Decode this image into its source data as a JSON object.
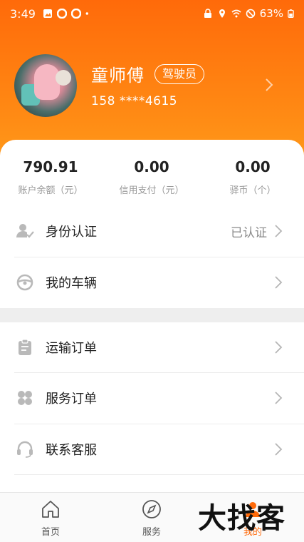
{
  "status_bar": {
    "time": "3:49",
    "battery": "63%"
  },
  "profile": {
    "name": "童师傅",
    "role": "驾驶员",
    "phone": "158 ****4615"
  },
  "stats": [
    {
      "value": "790.91",
      "label": "账户余额（元）"
    },
    {
      "value": "0.00",
      "label": "信用支付（元）"
    },
    {
      "value": "0.00",
      "label": "驿币（个）"
    }
  ],
  "menu": [
    {
      "label": "身份认证",
      "value": "已认证",
      "icon": "user-check-icon"
    },
    {
      "label": "我的车辆",
      "icon": "steering-wheel-icon"
    },
    {
      "label": "运输订单",
      "icon": "clipboard-icon"
    },
    {
      "label": "服务订单",
      "icon": "grid-icon"
    },
    {
      "label": "联系客服",
      "icon": "headset-icon"
    }
  ],
  "nav": [
    {
      "label": "首页",
      "icon": "home-icon"
    },
    {
      "label": "服务",
      "icon": "compass-icon"
    },
    {
      "label": "我的",
      "icon": "profile-icon"
    }
  ],
  "watermark": "大找客",
  "colors": {
    "accent": "#ff6a0a",
    "header_gradient_end": "#ff9a1a"
  }
}
